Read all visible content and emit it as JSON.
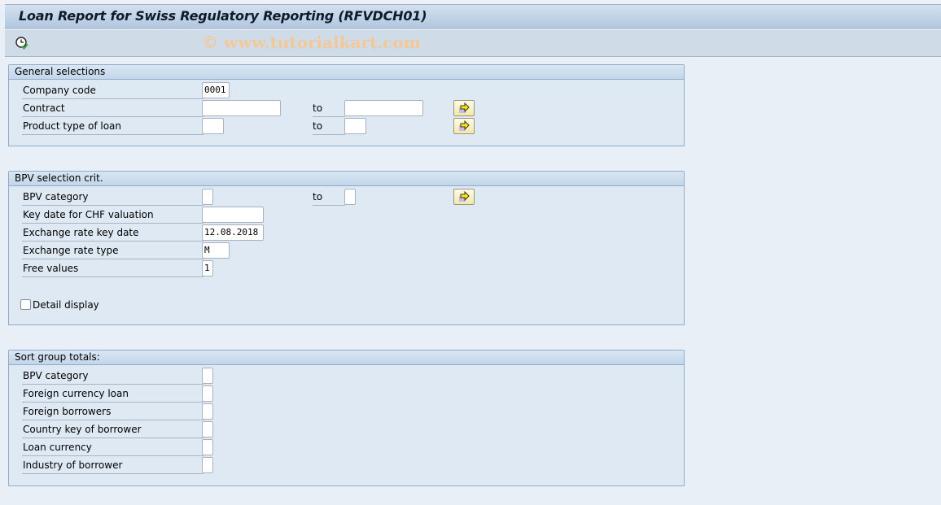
{
  "window": {
    "title": "Loan Report for Swiss Regulatory Reporting (RFVDCH01)",
    "watermark": "© www.tutorialkart.com"
  },
  "toolbar": {
    "execute_icon": "clock-check-icon"
  },
  "general_selections": {
    "title": "General selections",
    "rows": [
      {
        "label": "Company code",
        "value": "0001"
      },
      {
        "label": "Contract",
        "value": "",
        "to_label": "to",
        "to_value": ""
      },
      {
        "label": "Product type of loan",
        "value": "",
        "to_label": "to",
        "to_value": ""
      }
    ]
  },
  "bpv_selection": {
    "title": "BPV selection crit.",
    "rows": [
      {
        "label": "BPV category",
        "value": "",
        "to_label": "to",
        "to_value": ""
      },
      {
        "label": "Key date for CHF valuation",
        "value": ""
      },
      {
        "label": "Exchange rate key date",
        "value": "12.08.2018"
      },
      {
        "label": "Exchange rate type",
        "value": "M"
      },
      {
        "label": "Free values",
        "value": "1"
      }
    ],
    "detail_display": {
      "label": "Detail display",
      "checked": false
    }
  },
  "sort_group_totals": {
    "title": "Sort group totals:",
    "rows": [
      {
        "label": "BPV category",
        "value": ""
      },
      {
        "label": "Foreign currency loan",
        "value": ""
      },
      {
        "label": "Foreign borrowers",
        "value": ""
      },
      {
        "label": "Country key of borrower",
        "value": ""
      },
      {
        "label": "Loan currency",
        "value": ""
      },
      {
        "label": "Industry of borrower",
        "value": ""
      }
    ]
  },
  "icons": {
    "multiple_selection": "arrow-right-icon"
  }
}
